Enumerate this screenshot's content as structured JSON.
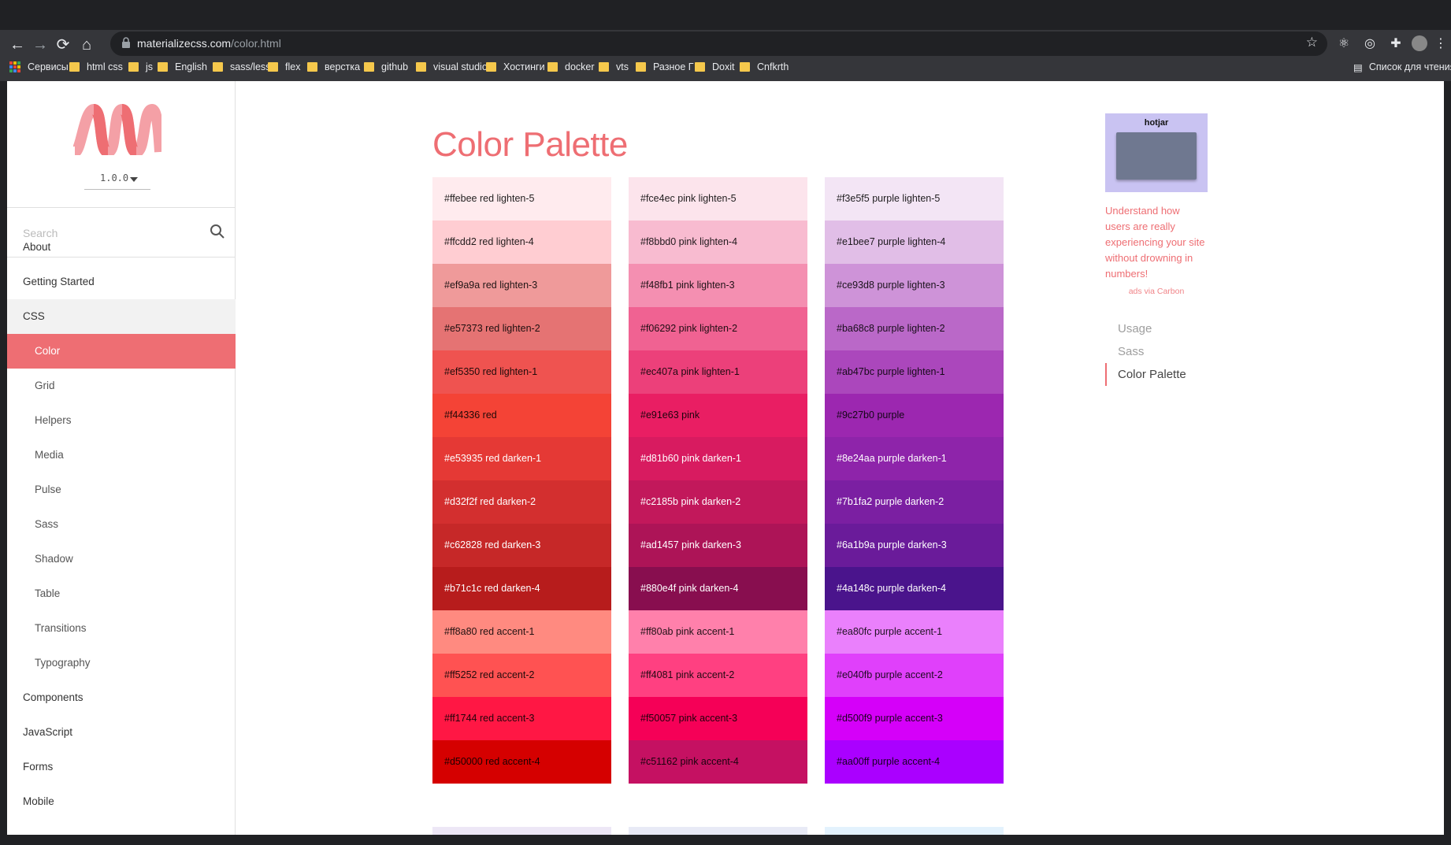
{
  "browser": {
    "url_host": "materializecss.com",
    "url_path": "/color.html",
    "bookmarks": [
      {
        "label": "Сервисы",
        "icon": "apps-grid-icon"
      },
      {
        "label": "html css",
        "icon": "folder-icon"
      },
      {
        "label": "js",
        "icon": "folder-icon"
      },
      {
        "label": "English",
        "icon": "folder-icon"
      },
      {
        "label": "sass/less",
        "icon": "folder-icon"
      },
      {
        "label": "flex",
        "icon": "folder-icon"
      },
      {
        "label": "верстка",
        "icon": "folder-icon"
      },
      {
        "label": "github",
        "icon": "folder-icon"
      },
      {
        "label": "visual studio",
        "icon": "folder-icon"
      },
      {
        "label": "Хостинги",
        "icon": "folder-icon"
      },
      {
        "label": "docker",
        "icon": "folder-icon"
      },
      {
        "label": "vts",
        "icon": "folder-icon"
      },
      {
        "label": "Разное Г",
        "icon": "folder-icon"
      },
      {
        "label": "Doxit",
        "icon": "folder-icon"
      },
      {
        "label": "Cnfkrth",
        "icon": "folder-icon"
      }
    ],
    "reading_list": "Список для чтения",
    "folder_color": "#f5c84c"
  },
  "sidebar": {
    "version": "1.0.0",
    "search_placeholder": "Search",
    "nav": [
      {
        "label": "About",
        "level": "top",
        "state": "normal"
      },
      {
        "label": "Getting Started",
        "level": "top",
        "state": "normal"
      },
      {
        "label": "CSS",
        "level": "top",
        "state": "group"
      },
      {
        "label": "Color",
        "level": "sub",
        "state": "active"
      },
      {
        "label": "Grid",
        "level": "sub",
        "state": "normal"
      },
      {
        "label": "Helpers",
        "level": "sub",
        "state": "normal"
      },
      {
        "label": "Media",
        "level": "sub",
        "state": "normal"
      },
      {
        "label": "Pulse",
        "level": "sub",
        "state": "normal"
      },
      {
        "label": "Sass",
        "level": "sub",
        "state": "normal"
      },
      {
        "label": "Shadow",
        "level": "sub",
        "state": "normal"
      },
      {
        "label": "Table",
        "level": "sub",
        "state": "normal"
      },
      {
        "label": "Transitions",
        "level": "sub",
        "state": "normal"
      },
      {
        "label": "Typography",
        "level": "sub",
        "state": "normal"
      },
      {
        "label": "Components",
        "level": "top",
        "state": "normal"
      },
      {
        "label": "JavaScript",
        "level": "top",
        "state": "normal"
      },
      {
        "label": "Forms",
        "level": "top",
        "state": "normal"
      },
      {
        "label": "Mobile",
        "level": "top",
        "state": "normal"
      }
    ],
    "accent": "#ee6e73"
  },
  "main": {
    "title": "Color Palette",
    "palettes": [
      [
        {
          "hex": "#ffebee",
          "name": "red lighten-5",
          "text": "dark"
        },
        {
          "hex": "#ffcdd2",
          "name": "red lighten-4",
          "text": "dark"
        },
        {
          "hex": "#ef9a9a",
          "name": "red lighten-3",
          "text": "dark"
        },
        {
          "hex": "#e57373",
          "name": "red lighten-2",
          "text": "dark"
        },
        {
          "hex": "#ef5350",
          "name": "red lighten-1",
          "text": "dark"
        },
        {
          "hex": "#f44336",
          "name": "red",
          "text": "dark"
        },
        {
          "hex": "#e53935",
          "name": "red darken-1",
          "text": "light"
        },
        {
          "hex": "#d32f2f",
          "name": "red darken-2",
          "text": "light"
        },
        {
          "hex": "#c62828",
          "name": "red darken-3",
          "text": "light"
        },
        {
          "hex": "#b71c1c",
          "name": "red darken-4",
          "text": "light"
        },
        {
          "hex": "#ff8a80",
          "name": "red accent-1",
          "text": "dark"
        },
        {
          "hex": "#ff5252",
          "name": "red accent-2",
          "text": "dark"
        },
        {
          "hex": "#ff1744",
          "name": "red accent-3",
          "text": "dark"
        },
        {
          "hex": "#d50000",
          "name": "red accent-4",
          "text": "dark"
        }
      ],
      [
        {
          "hex": "#fce4ec",
          "name": "pink lighten-5",
          "text": "dark"
        },
        {
          "hex": "#f8bbd0",
          "name": "pink lighten-4",
          "text": "dark"
        },
        {
          "hex": "#f48fb1",
          "name": "pink lighten-3",
          "text": "dark"
        },
        {
          "hex": "#f06292",
          "name": "pink lighten-2",
          "text": "dark"
        },
        {
          "hex": "#ec407a",
          "name": "pink lighten-1",
          "text": "dark"
        },
        {
          "hex": "#e91e63",
          "name": "pink",
          "text": "dark"
        },
        {
          "hex": "#d81b60",
          "name": "pink darken-1",
          "text": "light"
        },
        {
          "hex": "#c2185b",
          "name": "pink darken-2",
          "text": "light"
        },
        {
          "hex": "#ad1457",
          "name": "pink darken-3",
          "text": "light"
        },
        {
          "hex": "#880e4f",
          "name": "pink darken-4",
          "text": "light"
        },
        {
          "hex": "#ff80ab",
          "name": "pink accent-1",
          "text": "dark"
        },
        {
          "hex": "#ff4081",
          "name": "pink accent-2",
          "text": "dark"
        },
        {
          "hex": "#f50057",
          "name": "pink accent-3",
          "text": "dark"
        },
        {
          "hex": "#c51162",
          "name": "pink accent-4",
          "text": "dark"
        }
      ],
      [
        {
          "hex": "#f3e5f5",
          "name": "purple lighten-5",
          "text": "dark"
        },
        {
          "hex": "#e1bee7",
          "name": "purple lighten-4",
          "text": "dark"
        },
        {
          "hex": "#ce93d8",
          "name": "purple lighten-3",
          "text": "dark"
        },
        {
          "hex": "#ba68c8",
          "name": "purple lighten-2",
          "text": "dark"
        },
        {
          "hex": "#ab47bc",
          "name": "purple lighten-1",
          "text": "dark"
        },
        {
          "hex": "#9c27b0",
          "name": "purple",
          "text": "dark"
        },
        {
          "hex": "#8e24aa",
          "name": "purple darken-1",
          "text": "light"
        },
        {
          "hex": "#7b1fa2",
          "name": "purple darken-2",
          "text": "light"
        },
        {
          "hex": "#6a1b9a",
          "name": "purple darken-3",
          "text": "light"
        },
        {
          "hex": "#4a148c",
          "name": "purple darken-4",
          "text": "light"
        },
        {
          "hex": "#ea80fc",
          "name": "purple accent-1",
          "text": "dark"
        },
        {
          "hex": "#e040fb",
          "name": "purple accent-2",
          "text": "dark"
        },
        {
          "hex": "#d500f9",
          "name": "purple accent-3",
          "text": "dark"
        },
        {
          "hex": "#aa00ff",
          "name": "purple accent-4",
          "text": "dark"
        }
      ]
    ],
    "next_row_colors": [
      "#ede7f6",
      "#e8eaf6",
      "#e3f2fd"
    ]
  },
  "ad": {
    "brand": "hotjar",
    "text": "Understand how users are really experiencing your site without drowning in numbers!",
    "via": "ads via Carbon"
  },
  "toc": [
    {
      "label": "Usage",
      "active": false
    },
    {
      "label": "Sass",
      "active": false
    },
    {
      "label": "Color Palette",
      "active": true
    }
  ]
}
